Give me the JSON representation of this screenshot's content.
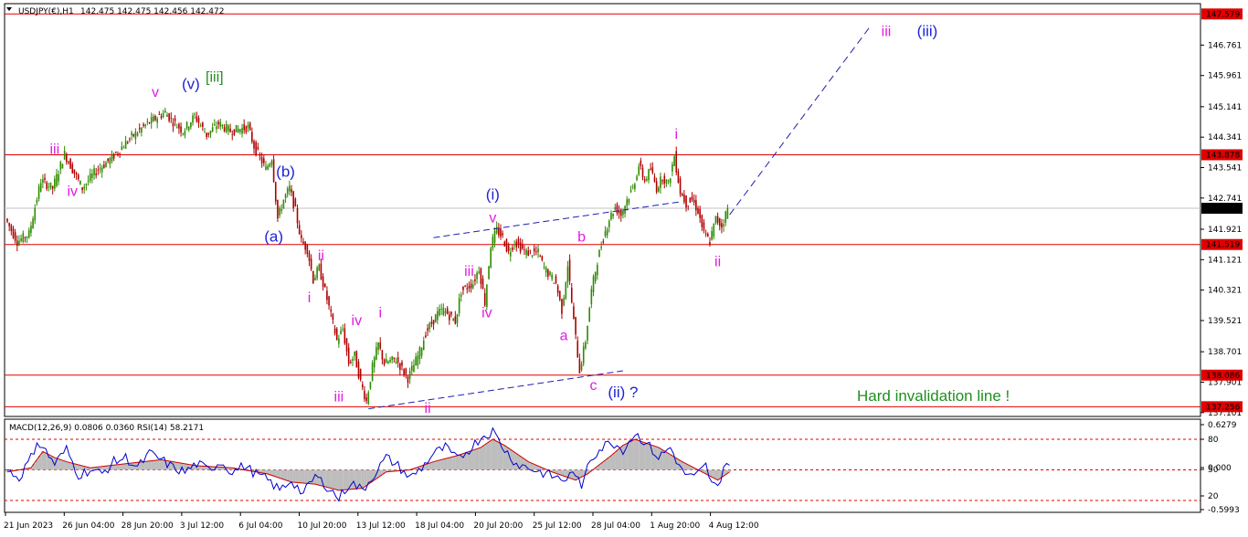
{
  "header": {
    "symbol": "USDJPY(€),H1",
    "ohlc": "142.475 142.475 142.456 142.472"
  },
  "chart_data": [
    {
      "type": "line",
      "title": "USDJPY(€),H1",
      "ylim": [
        136.9,
        147.9
      ],
      "y_ticks": [
        "146.761",
        "145.961",
        "145.141",
        "144.341",
        "143.541",
        "142.741",
        "141.921",
        "141.121",
        "140.321",
        "139.521",
        "138.701",
        "137.901",
        "137.101"
      ],
      "x_ticks": [
        "21 Jun 2023",
        "26 Jun 04:00",
        "28 Jun 20:00",
        "3 Jul 12:00",
        "6 Jul 04:00",
        "10 Jul 20:00",
        "13 Jul 12:00",
        "18 Jul 04:00",
        "20 Jul 20:00",
        "25 Jul 12:00",
        "28 Jul 04:00",
        "1 Aug 20:00",
        "4 Aug 12:00"
      ],
      "price_path": [
        [
          0,
          142.2
        ],
        [
          2,
          141.6
        ],
        [
          4,
          141.8
        ],
        [
          6,
          143.2
        ],
        [
          8,
          143.0
        ],
        [
          10,
          143.9
        ],
        [
          12,
          143.3
        ],
        [
          13,
          143.0
        ],
        [
          15,
          143.4
        ],
        [
          18,
          143.8
        ],
        [
          21,
          144.3
        ],
        [
          24,
          144.7
        ],
        [
          27,
          145.0
        ],
        [
          28,
          144.8
        ],
        [
          30,
          144.5
        ],
        [
          32,
          144.9
        ],
        [
          34,
          144.4
        ],
        [
          36,
          144.7
        ],
        [
          38,
          144.5
        ],
        [
          41,
          144.6
        ],
        [
          42,
          144.1
        ],
        [
          44,
          143.5
        ],
        [
          45,
          143.8
        ],
        [
          46,
          142.2
        ],
        [
          47,
          142.7
        ],
        [
          48,
          143.0
        ],
        [
          49,
          142.4
        ],
        [
          50,
          141.6
        ],
        [
          51,
          141.4
        ],
        [
          52,
          140.6
        ],
        [
          53,
          140.9
        ],
        [
          54,
          140.3
        ],
        [
          56,
          139.0
        ],
        [
          57,
          139.3
        ],
        [
          58,
          138.4
        ],
        [
          59,
          138.6
        ],
        [
          60,
          137.9
        ],
        [
          61,
          137.4
        ],
        [
          62,
          138.3
        ],
        [
          63,
          138.9
        ],
        [
          64,
          138.4
        ],
        [
          66,
          138.5
        ],
        [
          68,
          138.0
        ],
        [
          70,
          138.7
        ],
        [
          71,
          139.2
        ],
        [
          73,
          139.7
        ],
        [
          74,
          139.8
        ],
        [
          76,
          139.5
        ],
        [
          77,
          140.3
        ],
        [
          79,
          140.5
        ],
        [
          80,
          140.9
        ],
        [
          81,
          140.0
        ],
        [
          82,
          141.5
        ],
        [
          83,
          141.9
        ],
        [
          84,
          141.7
        ],
        [
          85,
          141.3
        ],
        [
          86,
          141.6
        ],
        [
          88,
          141.3
        ],
        [
          90,
          141.3
        ],
        [
          91,
          140.9
        ],
        [
          93,
          140.5
        ],
        [
          94,
          139.8
        ],
        [
          95,
          141.0
        ],
        [
          96,
          139.5
        ],
        [
          97,
          138.2
        ],
        [
          98,
          139.0
        ],
        [
          99,
          140.3
        ],
        [
          100,
          141.1
        ],
        [
          101,
          141.7
        ],
        [
          102,
          142.2
        ],
        [
          103,
          142.5
        ],
        [
          104,
          142.3
        ],
        [
          105,
          142.7
        ],
        [
          106,
          143.0
        ],
        [
          107,
          143.6
        ],
        [
          108,
          143.2
        ],
        [
          109,
          143.5
        ],
        [
          110,
          143.0
        ],
        [
          111,
          143.3
        ],
        [
          112,
          143.1
        ],
        [
          113,
          143.85
        ],
        [
          114,
          142.9
        ],
        [
          115,
          142.6
        ],
        [
          116,
          142.7
        ],
        [
          117,
          142.4
        ],
        [
          118,
          141.8
        ],
        [
          119,
          141.6
        ],
        [
          120,
          142.2
        ],
        [
          121,
          142.0
        ],
        [
          122,
          142.47
        ]
      ],
      "projection": [
        [
          122,
          142.3
        ],
        [
          145,
          147.3
        ]
      ],
      "horizontal_levels": [
        {
          "value": 147.579,
          "label": "147.579"
        },
        {
          "value": 143.878,
          "label": "143.878"
        },
        {
          "value": 141.519,
          "label": "141.519"
        },
        {
          "value": 138.086,
          "label": "138.086"
        },
        {
          "value": 137.256,
          "label": "137.256"
        }
      ],
      "current_price": {
        "value": 142.472,
        "label": "142.472"
      },
      "trendlines": [
        [
          [
            72,
            141.7
          ],
          [
            114,
            142.65
          ]
        ],
        [
          [
            61,
            137.2
          ],
          [
            104,
            138.2
          ]
        ]
      ],
      "wave_labels": [
        {
          "text": "iii",
          "x": 8,
          "y": 143.9,
          "color": "magenta"
        },
        {
          "text": "iv",
          "x": 11,
          "y": 142.8,
          "color": "magenta"
        },
        {
          "text": "v",
          "x": 25,
          "y": 145.4,
          "color": "magenta"
        },
        {
          "text": "(v)",
          "x": 31,
          "y": 145.6,
          "color": "blue"
        },
        {
          "text": "[iii]",
          "x": 35,
          "y": 145.8,
          "color": "green"
        },
        {
          "text": "(b)",
          "x": 47,
          "y": 143.3,
          "color": "blue"
        },
        {
          "text": "(a)",
          "x": 45,
          "y": 141.6,
          "color": "blue"
        },
        {
          "text": "ii",
          "x": 53,
          "y": 141.1,
          "color": "magenta"
        },
        {
          "text": "i",
          "x": 51,
          "y": 140.0,
          "color": "magenta"
        },
        {
          "text": "iv",
          "x": 59,
          "y": 139.4,
          "color": "magenta"
        },
        {
          "text": "i",
          "x": 63,
          "y": 139.6,
          "color": "magenta"
        },
        {
          "text": "iii",
          "x": 56,
          "y": 137.4,
          "color": "magenta"
        },
        {
          "text": "ii",
          "x": 71,
          "y": 137.1,
          "color": "magenta"
        },
        {
          "text": "iii",
          "x": 78,
          "y": 140.7,
          "color": "magenta"
        },
        {
          "text": "iv",
          "x": 81,
          "y": 139.6,
          "color": "magenta"
        },
        {
          "text": "(i)",
          "x": 82,
          "y": 142.7,
          "color": "blue"
        },
        {
          "text": "v",
          "x": 82,
          "y": 142.1,
          "color": "magenta"
        },
        {
          "text": "b",
          "x": 97,
          "y": 141.6,
          "color": "magenta"
        },
        {
          "text": "a",
          "x": 94,
          "y": 139.0,
          "color": "magenta"
        },
        {
          "text": "c",
          "x": 99,
          "y": 137.7,
          "color": "magenta"
        },
        {
          "text": "(ii) ?",
          "x": 104,
          "y": 137.5,
          "color": "blue"
        },
        {
          "text": "i",
          "x": 113,
          "y": 144.3,
          "color": "magenta"
        },
        {
          "text": "ii",
          "x": 120,
          "y": 140.95,
          "color": "magenta"
        },
        {
          "text": "iii",
          "x": 147,
          "y": 147.0,
          "color": "magenta"
        },
        {
          "text": "(iii)",
          "x": 155,
          "y": 147.0,
          "color": "blue"
        }
      ],
      "annotation": {
        "text": "Hard invalidation line !",
        "color": "green"
      }
    },
    {
      "type": "line",
      "title": "MACD(12,26,9) 0.0806 0.0360 RSI(14) 58.2171",
      "y_ticks": [
        "0.6279",
        "80",
        "0.000",
        "50",
        "20",
        "-0.5993"
      ],
      "rsi_levels": [
        80,
        50,
        20
      ],
      "rsi_path": [
        [
          0,
          50
        ],
        [
          2,
          42
        ],
        [
          4,
          62
        ],
        [
          5,
          78
        ],
        [
          6,
          72
        ],
        [
          8,
          56
        ],
        [
          10,
          70
        ],
        [
          12,
          45
        ],
        [
          14,
          50
        ],
        [
          16,
          46
        ],
        [
          18,
          58
        ],
        [
          20,
          62
        ],
        [
          22,
          52
        ],
        [
          24,
          66
        ],
        [
          26,
          60
        ],
        [
          28,
          52
        ],
        [
          30,
          48
        ],
        [
          32,
          56
        ],
        [
          34,
          50
        ],
        [
          36,
          58
        ],
        [
          38,
          48
        ],
        [
          40,
          54
        ],
        [
          42,
          46
        ],
        [
          44,
          40
        ],
        [
          46,
          30
        ],
        [
          48,
          40
        ],
        [
          50,
          26
        ],
        [
          52,
          44
        ],
        [
          54,
          34
        ],
        [
          56,
          22
        ],
        [
          58,
          38
        ],
        [
          60,
          30
        ],
        [
          62,
          46
        ],
        [
          64,
          62
        ],
        [
          66,
          54
        ],
        [
          68,
          42
        ],
        [
          70,
          52
        ],
        [
          72,
          66
        ],
        [
          74,
          72
        ],
        [
          76,
          60
        ],
        [
          78,
          70
        ],
        [
          80,
          82
        ],
        [
          82,
          88
        ],
        [
          84,
          70
        ],
        [
          86,
          56
        ],
        [
          88,
          52
        ],
        [
          90,
          48
        ],
        [
          92,
          44
        ],
        [
          94,
          40
        ],
        [
          96,
          48
        ],
        [
          97,
          28
        ],
        [
          98,
          58
        ],
        [
          100,
          70
        ],
        [
          102,
          78
        ],
        [
          104,
          70
        ],
        [
          106,
          86
        ],
        [
          108,
          76
        ],
        [
          110,
          62
        ],
        [
          112,
          72
        ],
        [
          114,
          48
        ],
        [
          116,
          42
        ],
        [
          118,
          54
        ],
        [
          119,
          36
        ],
        [
          120,
          32
        ],
        [
          121,
          54
        ],
        [
          122,
          58
        ]
      ],
      "signal_path": [
        [
          0,
          48
        ],
        [
          4,
          52
        ],
        [
          6,
          68
        ],
        [
          8,
          62
        ],
        [
          10,
          58
        ],
        [
          14,
          52
        ],
        [
          20,
          56
        ],
        [
          26,
          60
        ],
        [
          32,
          54
        ],
        [
          38,
          52
        ],
        [
          44,
          46
        ],
        [
          48,
          38
        ],
        [
          52,
          36
        ],
        [
          56,
          30
        ],
        [
          60,
          32
        ],
        [
          64,
          48
        ],
        [
          68,
          50
        ],
        [
          72,
          58
        ],
        [
          76,
          64
        ],
        [
          80,
          72
        ],
        [
          82,
          80
        ],
        [
          84,
          74
        ],
        [
          88,
          58
        ],
        [
          92,
          48
        ],
        [
          96,
          40
        ],
        [
          98,
          46
        ],
        [
          102,
          64
        ],
        [
          104,
          74
        ],
        [
          106,
          80
        ],
        [
          110,
          72
        ],
        [
          114,
          58
        ],
        [
          118,
          46
        ],
        [
          120,
          40
        ],
        [
          122,
          48
        ]
      ]
    }
  ],
  "colors": {
    "bull": "#2e8b00",
    "bear": "#b00000",
    "level": "#e00000",
    "trend": "#1f1fb0",
    "magenta": "#e21ce2",
    "blue": "#1f24d6",
    "green": "#1f8f1f",
    "rsi": "#0000cc",
    "signal": "#cc0000",
    "hist": "#bdbdbd",
    "label_bg": "#e00000",
    "cur_bg": "#000000"
  }
}
